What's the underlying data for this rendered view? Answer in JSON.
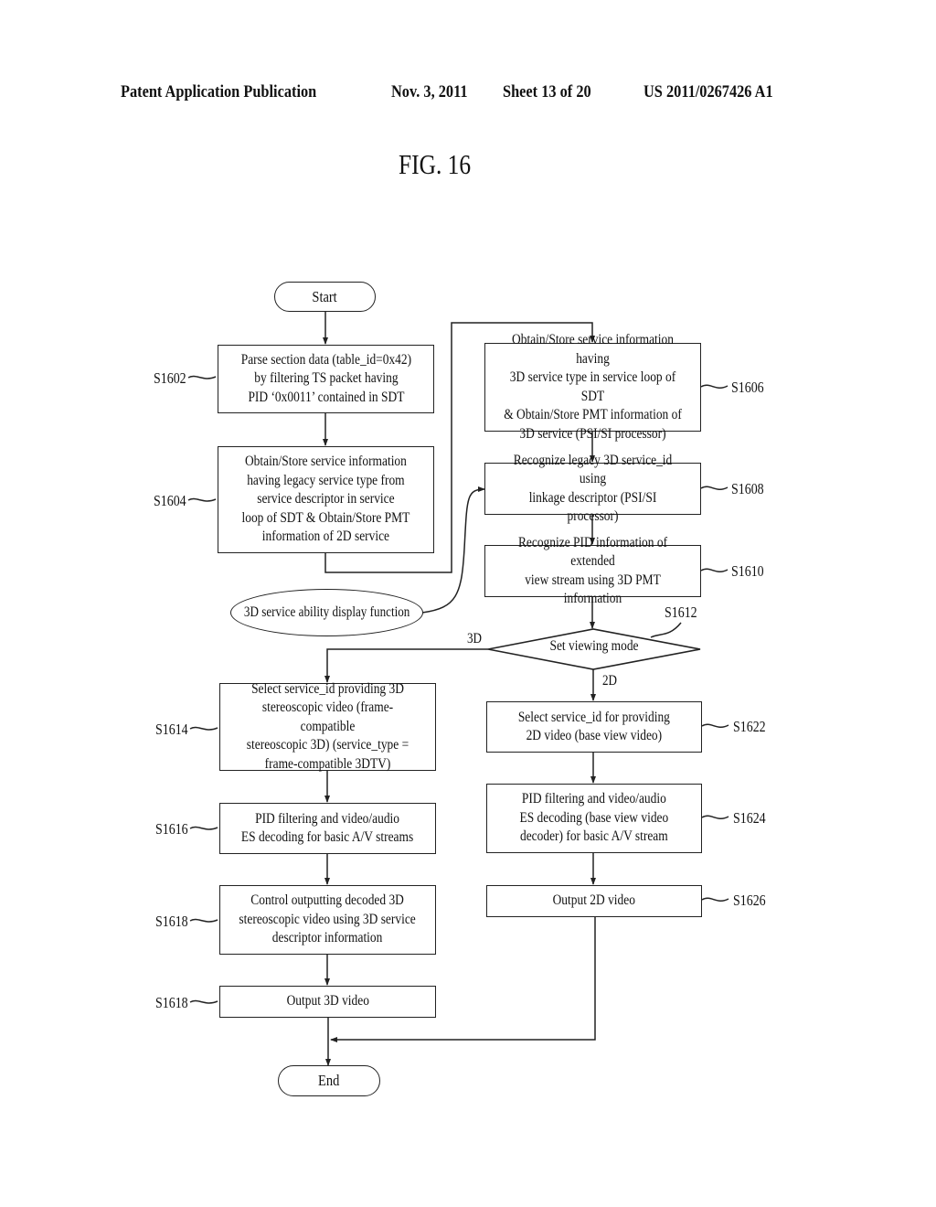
{
  "header": {
    "publication": "Patent Application Publication",
    "date": "Nov. 3, 2011",
    "sheet": "Sheet 13 of 20",
    "number": "US 2011/0267426 A1"
  },
  "figure_title": "FIG. 16",
  "flowchart": {
    "start": "Start",
    "end": "End",
    "ability_function": "3D service ability display function",
    "steps": {
      "s1602": {
        "label": "S1602",
        "text": "Parse section data (table_id=0x42)\nby filtering TS packet having\nPID ‘0x0011’ contained in SDT"
      },
      "s1604": {
        "label": "S1604",
        "text": "Obtain/Store service information\nhaving legacy service type from\nservice descriptor in service\nloop of SDT & Obtain/Store PMT\ninformation of 2D service"
      },
      "s1606": {
        "label": "S1606",
        "text": "Obtain/Store service information having\n3D service type in service loop of SDT\n& Obtain/Store PMT information of\n3D service  (PSI/SI processor)"
      },
      "s1608": {
        "label": "S1608",
        "text": "Recognize legacy 3D service_id using\nlinkage descriptor (PSI/SI processor)"
      },
      "s1610": {
        "label": "S1610",
        "text": "Recognize PID information of extended\nview stream using 3D PMT information"
      },
      "s1612": {
        "label": "S1612",
        "text": "Set viewing mode",
        "branch_3d": "3D",
        "branch_2d": "2D"
      },
      "s1614": {
        "label": "S1614",
        "text": "Select service_id providing 3D\nstereoscopic video (frame-compatible\nstereoscopic 3D) (service_type =\nframe-compatible 3DTV)"
      },
      "s1616": {
        "label": "S1616",
        "text": "PID filtering and video/audio\nES decoding for basic A/V streams"
      },
      "s1618a": {
        "label": "S1618",
        "text": "Control outputting decoded 3D\nstereoscopic video using 3D service\ndescriptor information"
      },
      "s1618b": {
        "label": "S1618",
        "text": "Output 3D video"
      },
      "s1622": {
        "label": "S1622",
        "text": "Select service_id for providing\n2D video (base view video)"
      },
      "s1624": {
        "label": "S1624",
        "text": "PID filtering and video/audio\nES decoding (base view video\ndecoder) for basic A/V stream"
      },
      "s1626": {
        "label": "S1626",
        "text": "Output 2D video"
      }
    }
  }
}
